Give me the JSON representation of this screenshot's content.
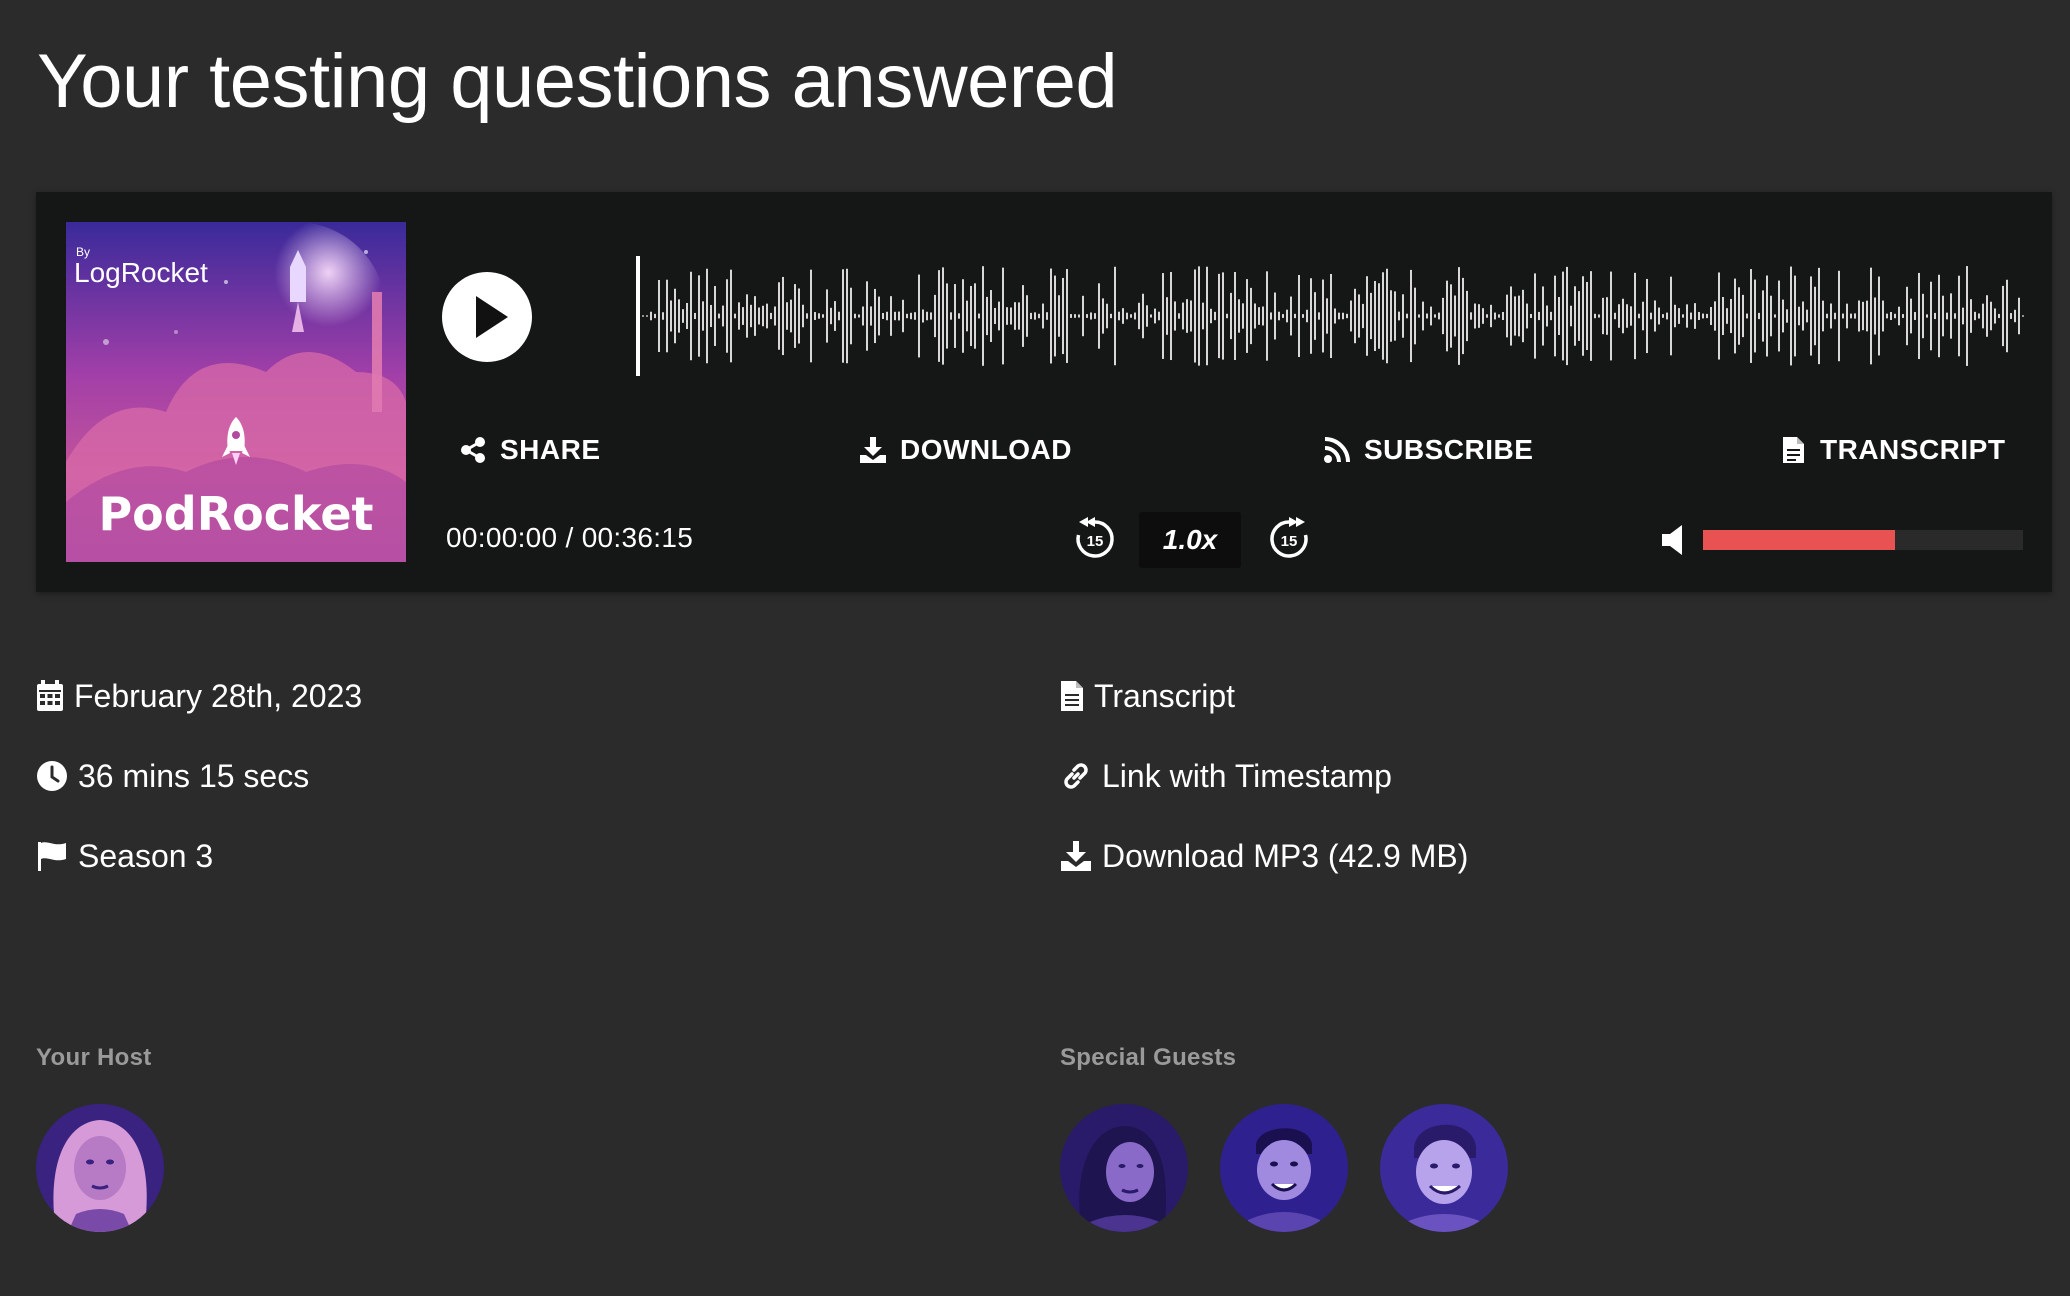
{
  "page": {
    "title": "Your testing questions answered"
  },
  "cover": {
    "by_label": "By",
    "brand": "LogRocket",
    "show_name": "PodRocket"
  },
  "player": {
    "actions": {
      "share": "SHARE",
      "download": "DOWNLOAD",
      "subscribe": "SUBSCRIBE",
      "transcript": "TRANSCRIPT"
    },
    "time_current": "00:00:00",
    "time_separator": "/",
    "time_total": "00:36:15",
    "speed": "1.0x",
    "skip_back_seconds": "15",
    "skip_forward_seconds": "15",
    "volume_level": 0.6,
    "playback_progress": 0.0
  },
  "meta": {
    "date": "February 28th, 2023",
    "duration": "36 mins 15 secs",
    "season": "Season 3",
    "transcript_link": "Transcript",
    "timestamp_link": "Link with Timestamp",
    "download_link": "Download MP3 (42.9 MB)"
  },
  "people": {
    "host_label": "Your Host",
    "guests_label": "Special Guests"
  },
  "colors": {
    "background": "#2b2b2b",
    "player_background": "#151616",
    "accent_volume": "#e95252",
    "cover_gradient_top": "#3d2a9e",
    "cover_gradient_bottom": "#7a3fc9"
  },
  "icons": {
    "share": "share-icon",
    "download": "download-icon",
    "subscribe": "rss-icon",
    "transcript": "document-icon",
    "date": "calendar-icon",
    "duration": "clock-icon",
    "season": "flag-icon",
    "timestamp": "link-icon",
    "volume": "speaker-icon",
    "play": "play-icon"
  }
}
